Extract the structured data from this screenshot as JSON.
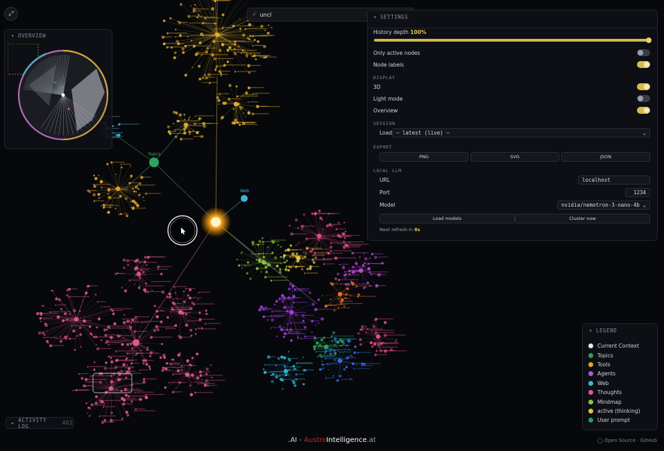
{
  "search": {
    "value": "uncl"
  },
  "overview": {
    "title": "OVERVIEW"
  },
  "graph_labels": {
    "topics": "Topics",
    "web": "Web"
  },
  "settings": {
    "title": "SETTINGS",
    "history_depth_label": "History depth",
    "history_depth_value": "100%",
    "history_depth_fraction": 1.0,
    "only_active_nodes": {
      "label": "Only active nodes",
      "on": false
    },
    "node_labels": {
      "label": "Node labels",
      "on": true
    },
    "display_section": "DISPLAY",
    "three_d": {
      "label": "3D",
      "on": true
    },
    "light_mode": {
      "label": "Light mode",
      "on": false
    },
    "overview_toggle": {
      "label": "Overview",
      "on": true
    },
    "session_section": "SESSION",
    "load_label": "Load",
    "load_value": "— latest (live) —",
    "export_section": "EXPORT",
    "export_png": "PNG",
    "export_svg": "SVG",
    "export_json": "JSON",
    "local_llm_section": "LOCAL LLM",
    "url_label": "URL",
    "url_value": "localhost",
    "port_label": "Port",
    "port_value": "1234",
    "model_label": "Model",
    "model_value": "nvidia/nemotron-3-nano-4b",
    "load_models": "Load models",
    "cluster_now": "Cluster now",
    "next_refresh_label": "Next refresh in",
    "next_refresh_value": "8s"
  },
  "legend": {
    "title": "LEGEND",
    "items": [
      {
        "label": "Current Context",
        "color": "#e8e8ea"
      },
      {
        "label": "Topics",
        "color": "#2e9e5e"
      },
      {
        "label": "Tools",
        "color": "#e0a62a"
      },
      {
        "label": "Agents",
        "color": "#a45ee0"
      },
      {
        "label": "Web",
        "color": "#3bb6d6"
      },
      {
        "label": "Thoughts",
        "color": "#e0578f"
      },
      {
        "label": "Mindmap",
        "color": "#8cc43a"
      },
      {
        "label": "active (thinking)",
        "color": "#e6c438"
      },
      {
        "label": "User prompt",
        "color": "#23a060"
      }
    ]
  },
  "activity_log": {
    "label": "ACTIVITY LOG",
    "count": "461"
  },
  "brand": {
    "prefix": ".AI",
    "sep": "-",
    "austro": "Austro",
    "intel": "Intelligence",
    "suffix": ".at"
  },
  "footer": {
    "github": "Open Source · GitHub"
  }
}
